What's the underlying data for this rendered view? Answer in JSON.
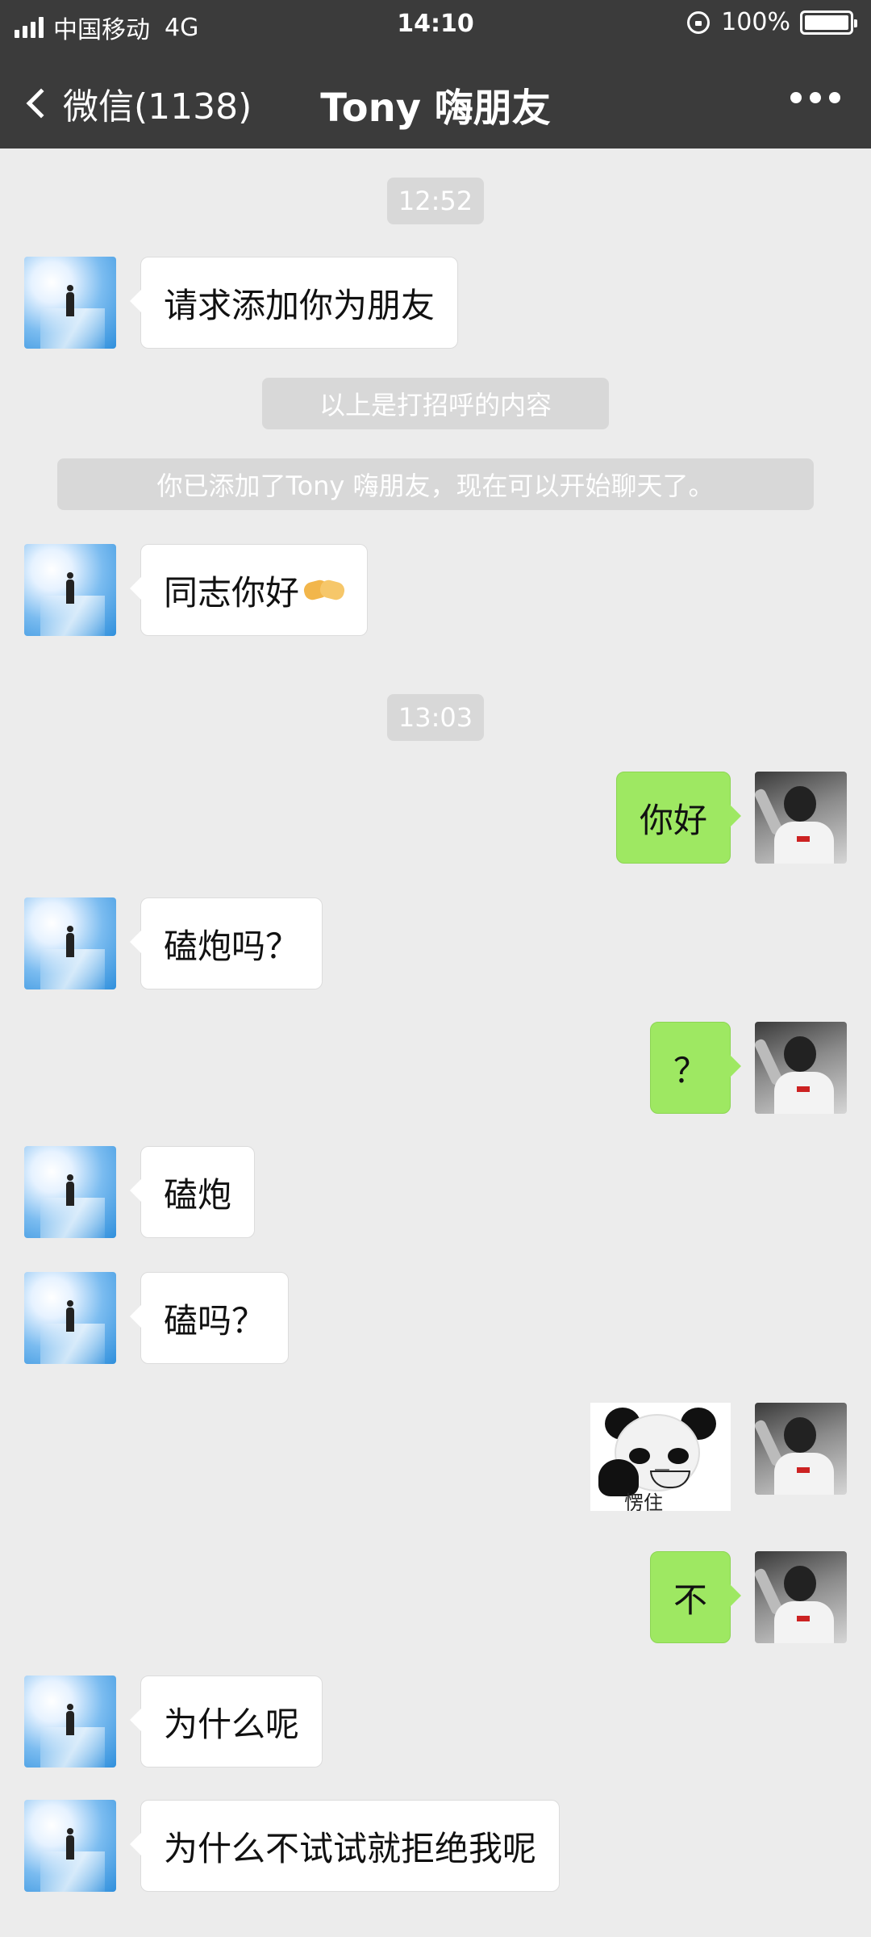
{
  "status_bar": {
    "carrier": "中国移动",
    "network": "4G",
    "time": "14:10",
    "battery": "100%"
  },
  "nav": {
    "back_label": "微信(1138)",
    "title": "Tony 嗨朋友"
  },
  "messages": [
    {
      "kind": "time",
      "text": "12:52"
    },
    {
      "kind": "friend",
      "text": "请求添加你为朋友"
    },
    {
      "kind": "system",
      "text": "以上是打招呼的内容"
    },
    {
      "kind": "system",
      "text": "你已添加了Tony 嗨朋友，现在可以开始聊天了。"
    },
    {
      "kind": "friend",
      "text": "同志你好",
      "emoji": "handshake-emoji"
    },
    {
      "kind": "time",
      "text": "13:03"
    },
    {
      "kind": "me",
      "text": "你好"
    },
    {
      "kind": "friend",
      "text": "磕炮吗？"
    },
    {
      "kind": "me",
      "text": "？"
    },
    {
      "kind": "friend",
      "text": "磕炮"
    },
    {
      "kind": "friend",
      "text": "磕吗？"
    },
    {
      "kind": "me_sticker",
      "caption": "愣住",
      "sticker": "panda-meme-sticker"
    },
    {
      "kind": "me",
      "text": "不"
    },
    {
      "kind": "friend",
      "text": "为什么呢"
    },
    {
      "kind": "friend",
      "text": "为什么不试试就拒绝我呢"
    }
  ],
  "colors": {
    "header": "#3b3b3b",
    "chat_bg": "#ececec",
    "my_bubble": "#9ee862",
    "friend_bubble": "#ffffff",
    "pill": "#d8d8d8"
  },
  "icons": {
    "back": "chevron-left-icon",
    "more": "more-dots-icon",
    "lock": "orientation-lock-icon",
    "battery": "battery-icon",
    "signal": "signal-bars-icon"
  }
}
